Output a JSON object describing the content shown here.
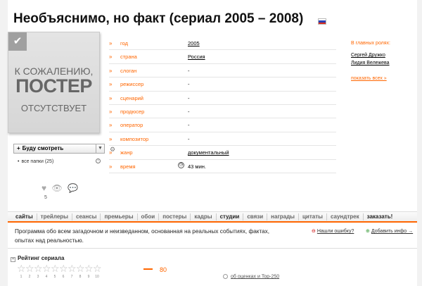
{
  "title": "Необъяснимо, но факт (сериал 2005 – 2008)",
  "poster": {
    "line1": "К СОЖАЛЕНИЮ,",
    "line2": "ПОСТЕР",
    "line3": "ОТСУТСТВУЕТ",
    "corner_icon": "checkmark-icon"
  },
  "watch_button": {
    "label": "Буду смотреть",
    "plus": "+",
    "arrow": "▼"
  },
  "gear_icon": "⚙",
  "folders": {
    "label": "все папки (25)",
    "info": "i"
  },
  "social": {
    "like": "♥",
    "view": "👁",
    "comment": "💬",
    "count": "5"
  },
  "info_rows": [
    {
      "key": "год",
      "value": "2005",
      "link": true
    },
    {
      "key": "страна",
      "value": "Россия",
      "link": true
    },
    {
      "key": "слоган",
      "value": "-",
      "link": false
    },
    {
      "key": "режиссер",
      "value": "-",
      "link": false
    },
    {
      "key": "сценарий",
      "value": "-",
      "link": false
    },
    {
      "key": "продюсер",
      "value": "-",
      "link": false
    },
    {
      "key": "оператор",
      "value": "-",
      "link": false
    },
    {
      "key": "композитор",
      "value": "-",
      "link": false
    },
    {
      "key": "жанр",
      "value": "документальный",
      "link": true
    },
    {
      "key": "время",
      "value": "43 мин.",
      "link": false,
      "clock": true
    }
  ],
  "cast": {
    "heading": "В главных ролях:",
    "actors": [
      "Сергей Дружко",
      "Лидия Вележева"
    ],
    "show_all": "показать всех »"
  },
  "tabs": [
    {
      "label": "сайты",
      "dark": true
    },
    {
      "label": "трейлеры",
      "dark": false
    },
    {
      "label": "сеансы",
      "dark": false
    },
    {
      "label": "премьеры",
      "dark": false
    },
    {
      "label": "обои",
      "dark": false
    },
    {
      "label": "постеры",
      "dark": false
    },
    {
      "label": "кадры",
      "dark": false
    },
    {
      "label": "студии",
      "dark": true
    },
    {
      "label": "связи",
      "dark": false
    },
    {
      "label": "награды",
      "dark": false
    },
    {
      "label": "цитаты",
      "dark": false
    },
    {
      "label": "саундтрек",
      "dark": false
    },
    {
      "label": "заказать!",
      "dark": true
    }
  ],
  "description": "Программа обо всем загадочном и неизведанном, основанная на реальных событиях, фактах, опытах над реальностью.",
  "report_error": "Нашли ошибку?",
  "add_info": "Добавить инфо →",
  "rating": {
    "heading": "Рейтинг сериала",
    "collapse": "−",
    "stars": [
      "1",
      "2",
      "3",
      "4",
      "5",
      "6",
      "7",
      "8",
      "9",
      "10"
    ],
    "score": "80",
    "link": "об оценках и Top-250"
  },
  "colors": {
    "accent": "#ff6600"
  }
}
